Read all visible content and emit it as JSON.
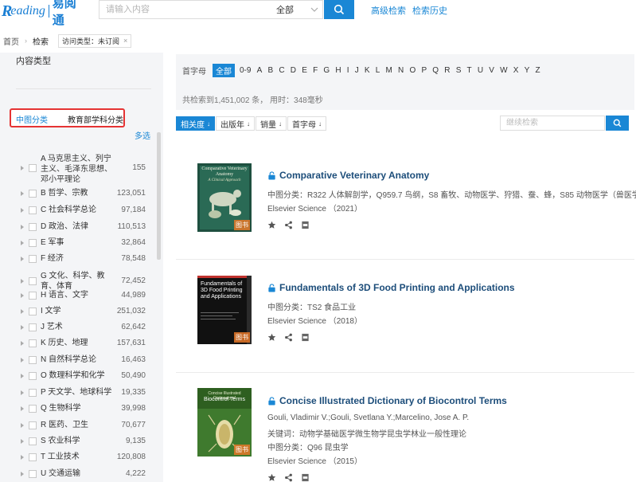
{
  "header": {
    "logo_main": "R",
    "logo_rest": "eading",
    "logo_cn": "易阅通",
    "search_placeholder": "请输入内容",
    "scope": "全部",
    "advanced_search": "高级检索",
    "search_history": "检索历史"
  },
  "breadcrumb": {
    "home": "首页",
    "current": "检索",
    "tag": "访问类型：未订阅"
  },
  "sidebar": {
    "content_type_title": "内容类型",
    "tab_clc": "中图分类",
    "tab_moe": "教育部学科分类",
    "multi_select": "多选",
    "categories": [
      {
        "label": "A 马克思主义、列宁主义、毛泽东思想、邓小平理论",
        "count": "155"
      },
      {
        "label": "B 哲学、宗教",
        "count": "123,051"
      },
      {
        "label": "C 社会科学总论",
        "count": "97,184"
      },
      {
        "label": "D 政治、法律",
        "count": "110,513"
      },
      {
        "label": "E 军事",
        "count": "32,864"
      },
      {
        "label": "F 经济",
        "count": "78,548"
      },
      {
        "label": "G 文化、科学、教育、体育",
        "count": "72,452"
      },
      {
        "label": "H 语言、文字",
        "count": "44,989"
      },
      {
        "label": "I 文学",
        "count": "251,032"
      },
      {
        "label": "J 艺术",
        "count": "62,642"
      },
      {
        "label": "K 历史、地理",
        "count": "157,631"
      },
      {
        "label": "N 自然科学总论",
        "count": "16,463"
      },
      {
        "label": "O 数理科学和化学",
        "count": "50,490"
      },
      {
        "label": "P 天文学、地球科学",
        "count": "19,335"
      },
      {
        "label": "Q 生物科学",
        "count": "39,998"
      },
      {
        "label": "R 医药、卫生",
        "count": "70,677"
      },
      {
        "label": "S 农业科学",
        "count": "9,135"
      },
      {
        "label": "T 工业技术",
        "count": "120,808"
      },
      {
        "label": "U 交通运输",
        "count": "4,222"
      }
    ]
  },
  "filter": {
    "initial_label": "首字母",
    "all": "全部",
    "letters": [
      "0-9",
      "A",
      "B",
      "C",
      "D",
      "E",
      "F",
      "G",
      "H",
      "I",
      "J",
      "K",
      "L",
      "M",
      "N",
      "O",
      "P",
      "Q",
      "R",
      "S",
      "T",
      "U",
      "V",
      "W",
      "X",
      "Y",
      "Z"
    ],
    "stats": "共检索到1,451,002 条， 用时：348毫秒"
  },
  "sort": {
    "relevance": "相关度",
    "pub_year": "出版年",
    "sales": "销量",
    "initial": "首字母",
    "arrow": "↓",
    "within_placeholder": "继续检索"
  },
  "results": [
    {
      "title": "Comparative Veterinary Anatomy",
      "lines": [
        "中图分类：R322 人体解剖学，Q959.7 鸟纲，S8 畜牧、动物医学、狩猎、蚕、蜂，S85 动物医学（兽医学..."
      ],
      "publisher": "Elsevier Science",
      "year": "（2021）",
      "cover_title": "Comparative Veterinary Anatomy",
      "cover_subtitle": "A Clinical Approach",
      "badge": "图书"
    },
    {
      "title": "Fundamentals of 3D Food Printing and Applications",
      "lines": [
        "中图分类：TS2 食品工业"
      ],
      "publisher": "Elsevier Science",
      "year": "（2018）",
      "cover_title": "Fundamentals of 3D Food Printing and Applications",
      "cover_subtitle": "",
      "badge": "图书"
    },
    {
      "title": "Concise Illustrated Dictionary of Biocontrol Terms",
      "lines": [
        "Gouli, Vladimir V.;Gouli, Svetlana Y.;Marcelino, Jose A. P.",
        "关键词：动物学基础医学微生物学昆虫学林业一般性理论",
        "中图分类：Q96 昆虫学"
      ],
      "publisher": "Elsevier Science",
      "year": "（2015）",
      "cover_title": "Biocontrol Terms",
      "cover_subtitle": "Concise Illustrated Dictionary of",
      "badge": "图书"
    }
  ],
  "colors": {
    "accent": "#1a87d5",
    "title": "#1c4d7a",
    "highlight_border": "#e53333",
    "sidebar_bg": "#f4f5f7"
  },
  "icons": [
    "search-icon",
    "chevron-down-icon",
    "lock-icon",
    "star-icon",
    "share-icon",
    "pdf-icon",
    "close-icon"
  ]
}
